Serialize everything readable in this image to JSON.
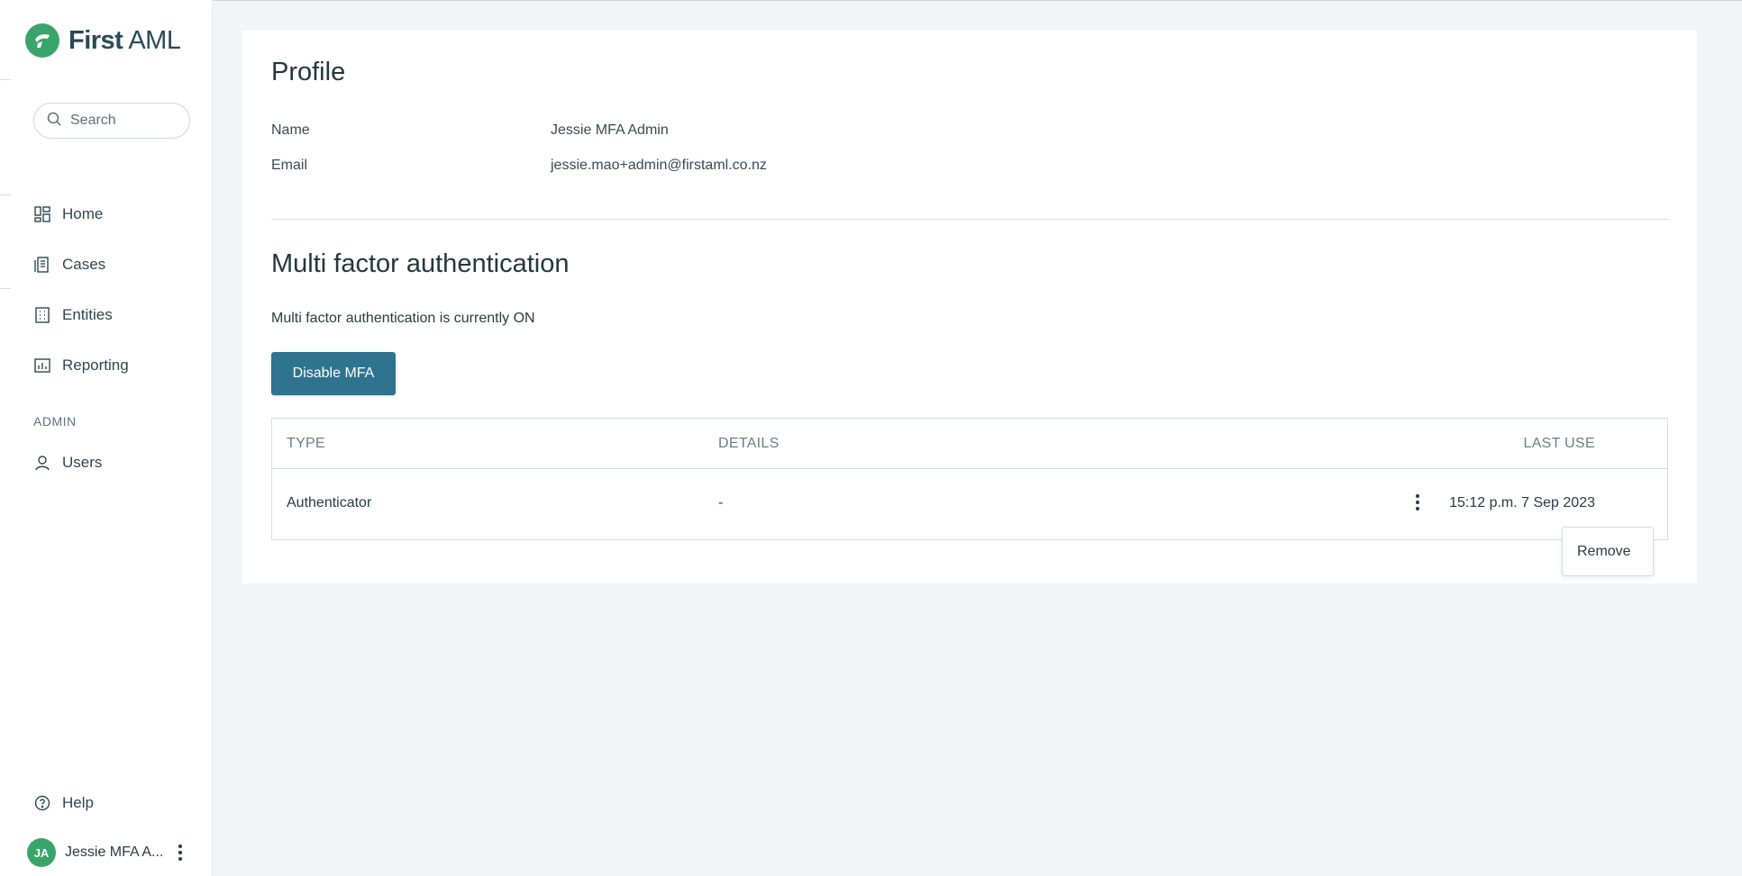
{
  "brand": {
    "bold": "First",
    "light": "AML"
  },
  "search": {
    "placeholder": "Search"
  },
  "sidebar": {
    "items": [
      {
        "label": "Home",
        "icon": "dashboard-icon"
      },
      {
        "label": "Cases",
        "icon": "document-icon"
      },
      {
        "label": "Entities",
        "icon": "building-icon"
      },
      {
        "label": "Reporting",
        "icon": "chart-icon"
      }
    ],
    "section_admin": "ADMIN",
    "admin_items": [
      {
        "label": "Users",
        "icon": "user-icon"
      }
    ],
    "help": "Help"
  },
  "user": {
    "initials": "JA",
    "name": "Jessie MFA A..."
  },
  "profile": {
    "title": "Profile",
    "fields": [
      {
        "label": "Name",
        "value": "Jessie MFA Admin"
      },
      {
        "label": "Email",
        "value": "jessie.mao+admin@firstaml.co.nz"
      }
    ]
  },
  "mfa": {
    "title": "Multi factor authentication",
    "status": "Multi factor authentication is currently ON",
    "button": "Disable MFA",
    "table": {
      "headers": {
        "type": "TYPE",
        "details": "DETAILS",
        "last_use": "LAST USE"
      },
      "rows": [
        {
          "type": "Authenticator",
          "details": "-",
          "last_use": "15:12 p.m. 7 Sep 2023"
        }
      ]
    },
    "menu": {
      "remove": "Remove"
    }
  },
  "colors": {
    "accent": "#2f738f",
    "brand_green": "#3aa56a",
    "background": "#f2f5f8"
  }
}
